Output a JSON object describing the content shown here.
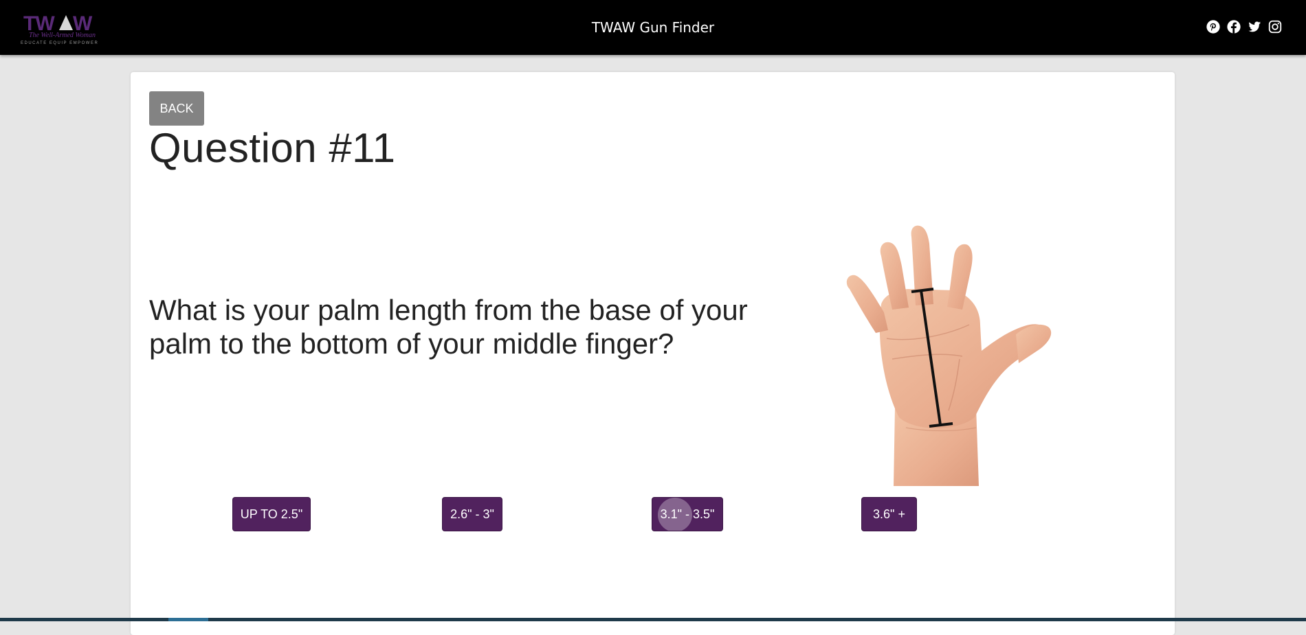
{
  "header": {
    "logo_text": "TWAW",
    "logo_tagline": "The Well-Armed Woman",
    "logo_subline": "EDUCATE EQUIP EMPOWER",
    "title": "TWAW Gun Finder",
    "social_icons": [
      "pinterest-icon",
      "facebook-icon",
      "twitter-icon",
      "instagram-icon"
    ]
  },
  "quiz": {
    "back_label": "BACK",
    "question_title": "Question #11",
    "question_text": "What is your palm length from the base of your palm to the bottom of your middle finger?",
    "answers": [
      "UP TO 2.5\"",
      "2.6\" - 3\"",
      "3.1\" - 3.5\"",
      "3.6\" +"
    ]
  },
  "colors": {
    "header_bg": "#000000",
    "page_bg": "#e6e6e6",
    "brand_purple": "#51225e",
    "back_button": "#838383"
  }
}
